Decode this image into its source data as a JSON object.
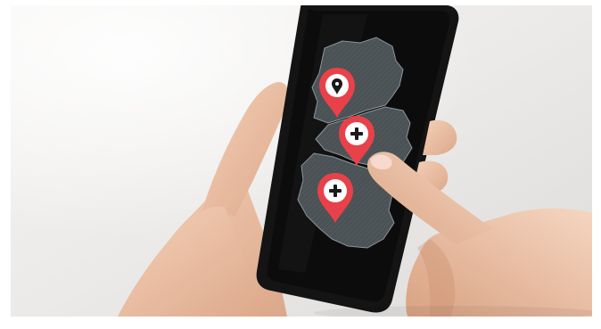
{
  "scene": {
    "description_colors": {
      "wall": "#ecebea",
      "phone_body": "#131313",
      "screen": "#0d0d0d",
      "map_region": "#4b5256",
      "region_border": "#9aa2a6",
      "pin": "#e8414a",
      "skin": "#efc4a6"
    },
    "pins": [
      {
        "icon": "location-pin-icon"
      },
      {
        "icon": "plus-pin-icon"
      },
      {
        "icon": "plus-pin-icon"
      }
    ]
  }
}
